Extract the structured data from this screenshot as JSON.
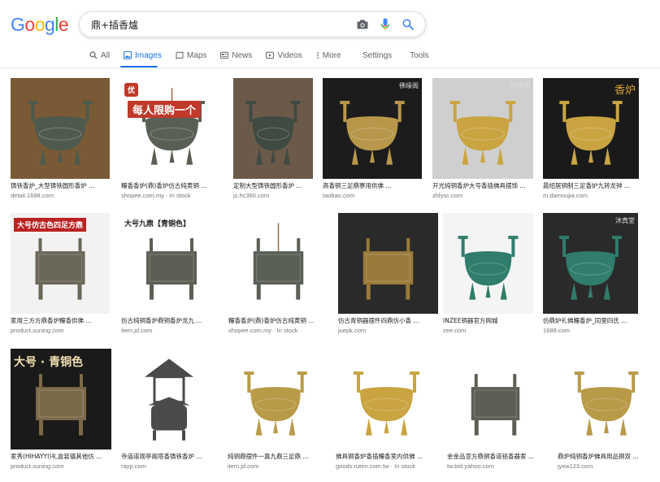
{
  "logo": {
    "letters": [
      "G",
      "o",
      "o",
      "g",
      "l",
      "e"
    ],
    "colors": [
      "#4285f4",
      "#ea4335",
      "#fbbc05",
      "#4285f4",
      "#34a853",
      "#ea4335"
    ]
  },
  "search": {
    "query": "鼎+插香爐"
  },
  "tabs": [
    {
      "label": "All",
      "icon": "search-icon"
    },
    {
      "label": "Images",
      "icon": "image-icon",
      "active": true
    },
    {
      "label": "Maps",
      "icon": "map-icon"
    },
    {
      "label": "News",
      "icon": "news-icon"
    },
    {
      "label": "Videos",
      "icon": "video-icon"
    },
    {
      "label": "More",
      "icon": "more-icon"
    }
  ],
  "tools": {
    "settings": "Settings",
    "tools": "Tools"
  },
  "results": [
    {
      "caption": "铸铁香炉_大型铸铁圆形香炉 ...",
      "source": "detail.1688.com",
      "bg": "#7a5a34",
      "metal": "#4f5a4e"
    },
    {
      "caption": "糧香香炉(鼎)香炉仿古纯黄铜 ...",
      "source": "shopee.com.my · In stock",
      "bg": "#ffffff",
      "metal": "#5a5f55",
      "overlay_top": "优",
      "overlay_text": "每人限购一个"
    },
    {
      "caption": "定制大型铸铁圆形香炉 ...",
      "source": "js.hc360.com",
      "bg": "#6b5a4a",
      "metal": "#3f4a42"
    },
    {
      "caption": "高香铜三足鼎寮用供佛 ...",
      "source": "taobao.com",
      "bg": "#1c1c1c",
      "metal": "#b8974a",
      "corner_label": "佛缘阁"
    },
    {
      "caption": "开光纯铜香炉大号香插佛具摆饰 ...",
      "source": "zhlysc.com",
      "bg": "#cfcfcf",
      "metal": "#c9a441",
      "corner_label": "佛缘阁"
    },
    {
      "caption": "晨绍居铜制三足香炉九转龙钟 ...",
      "source": "m.damoujia.com",
      "bg": "#1a1a1a",
      "metal": "#c9a441",
      "corner_label": "香炉"
    },
    {
      "caption": "家用三方方鼎香炉糧香供佛 ...",
      "source": "product.suning.com",
      "bg": "#f2f2f2",
      "metal": "#6a6658",
      "overlay_top": "大号仿古色四足方鼎"
    },
    {
      "caption": "仿古纯铜香炉鼎铜香炉龙九 ...",
      "source": "item.jd.com",
      "bg": "#ffffff",
      "metal": "#5f5e55",
      "overlay_top": "大号九鼎【青铜色】"
    },
    {
      "caption": "糧香香炉(鼎)香炉仿古纯黄铜 ...",
      "source": "shopee.com.my · In stock",
      "bg": "#ffffff",
      "metal": "#5a5f55"
    },
    {
      "caption": "仿古青铜器摆件四鼎仿小香 ...",
      "source": "juepk.com",
      "bg": "#2a2a2a",
      "metal": "#9a7a3a"
    },
    {
      "caption": "INZEE铜器官方网城",
      "source": "zee.com",
      "bg": "#f4f4f4",
      "metal": "#2f7d6a"
    },
    {
      "caption": "仿鼎炉礼佛糧香炉_同里四氏 ...",
      "source": "1688.com",
      "bg": "#2a2a2a",
      "metal": "#2f7d6a",
      "corner_label": "沐真堂"
    },
    {
      "caption": "家秀(HIHAYYI)礼盒装镇其他仿 ...",
      "source": "product.suning.com",
      "bg": "#1a1a1a",
      "metal": "#7a6a48",
      "overlay_top": "大号 · 青铜色"
    },
    {
      "caption": "寺庙道观亭阁塔香铸铁香炉 ...",
      "source": "rayp.com",
      "bg": "#ffffff",
      "metal": "#4a4a48"
    },
    {
      "caption": "纯铜鼎摆件一真九鼎三足鼎 ...",
      "source": "item.jd.com",
      "bg": "#ffffff",
      "metal": "#b89a48"
    },
    {
      "caption": "佛具铜香炉香插糧香室内供佛 ...",
      "source": "goods.ruten.com.tw · In stock",
      "bg": "#ffffff",
      "metal": "#c9a441"
    },
    {
      "caption": "金金品亚方鼎铜香道铭香器家 ...",
      "source": "tw.bid.yahoo.com",
      "bg": "#ffffff",
      "metal": "#5f5e55"
    },
    {
      "caption": "鼎炉纯铜香炉佛具用品铜双 ...",
      "source": "jyxw123.com",
      "bg": "#ffffff",
      "metal": "#b89a48"
    }
  ]
}
